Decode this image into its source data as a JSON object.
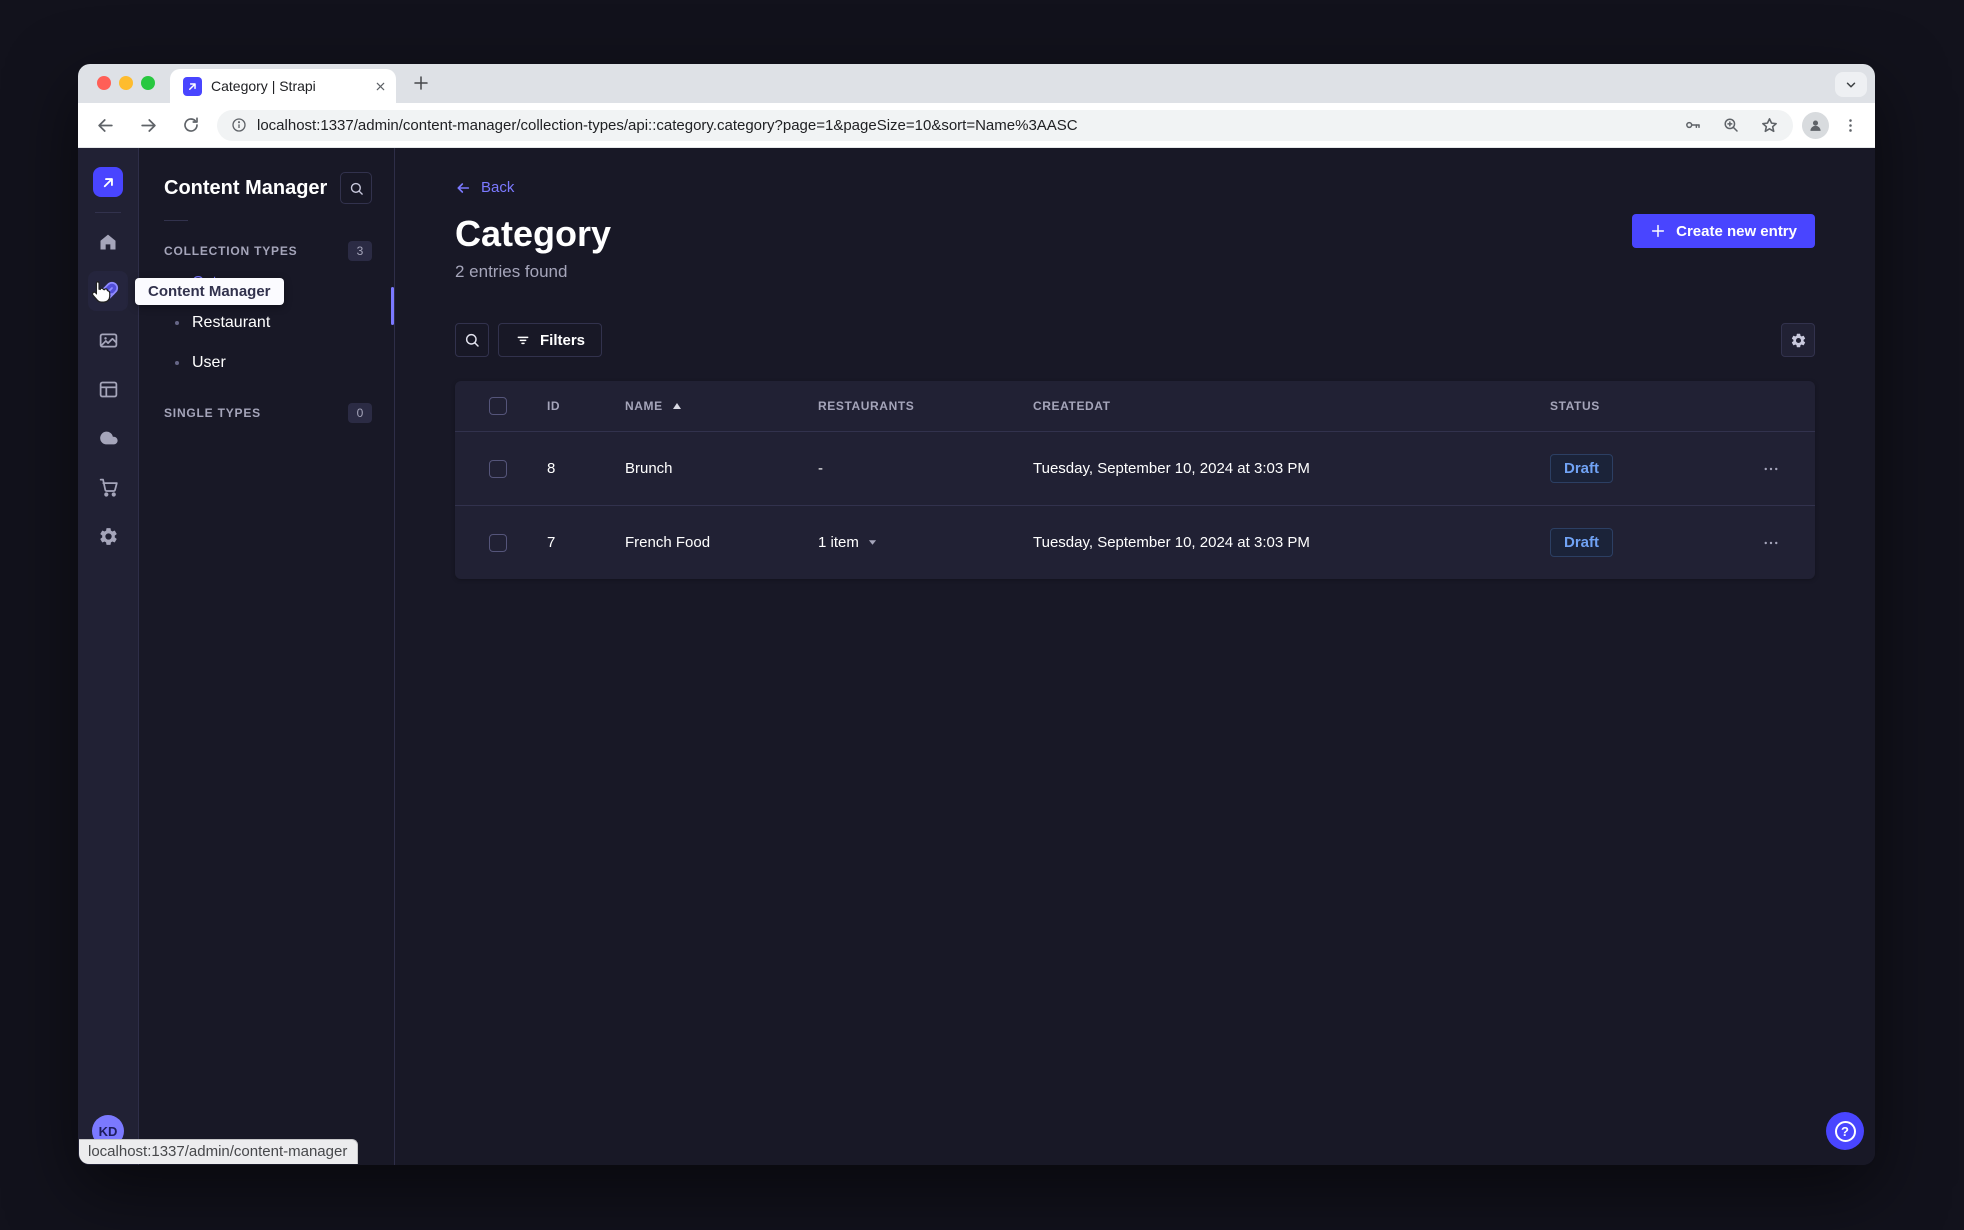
{
  "browser": {
    "tab": {
      "title": "Category | Strapi",
      "close_glyph": "×"
    },
    "url": "localhost:1337/admin/content-manager/collection-types/api::category.category?page=1&pageSize=10&sort=Name%3AASC",
    "status_bar_url": "localhost:1337/admin/content-manager"
  },
  "rail": {
    "items": [
      {
        "name": "home"
      },
      {
        "name": "content-manager",
        "active": true
      },
      {
        "name": "media-library"
      },
      {
        "name": "content-type-builder"
      },
      {
        "name": "cloud"
      },
      {
        "name": "marketplace"
      },
      {
        "name": "settings"
      }
    ],
    "avatar_initials": "KD"
  },
  "tooltip": {
    "text": "Content Manager"
  },
  "subnav": {
    "title": "Content Manager",
    "collection_types": {
      "label": "COLLECTION TYPES",
      "badge": "3",
      "items": [
        {
          "label": "Category",
          "active": true
        },
        {
          "label": "Restaurant",
          "active": false
        },
        {
          "label": "User",
          "active": false
        }
      ]
    },
    "single_types": {
      "label": "SINGLE TYPES",
      "badge": "0"
    }
  },
  "content": {
    "back_label": "Back",
    "title": "Category",
    "entries_count": "2 entries found",
    "create_button_label": "Create new entry",
    "filters_label": "Filters",
    "table": {
      "headers": {
        "id": "ID",
        "name": "NAME",
        "restaurants": "RESTAURANTS",
        "createdat": "CREATEDAT",
        "status": "STATUS"
      },
      "sort": {
        "column": "NAME",
        "direction": "asc"
      },
      "rows": [
        {
          "id": "8",
          "name": "Brunch",
          "restaurants": "-",
          "createdat": "Tuesday, September 10, 2024 at 3:03 PM",
          "status": "Draft"
        },
        {
          "id": "7",
          "name": "French Food",
          "restaurants": "1 item",
          "createdat": "Tuesday, September 10, 2024 at 3:03 PM",
          "status": "Draft"
        }
      ]
    }
  },
  "colors": {
    "primary": "#4945ff",
    "primary_light": "#7b79ff",
    "page_background": "#181826",
    "surface_background": "#212134",
    "border": "#32324d",
    "muted_text": "#a5a5ba",
    "draft_text": "#71a3f5"
  }
}
